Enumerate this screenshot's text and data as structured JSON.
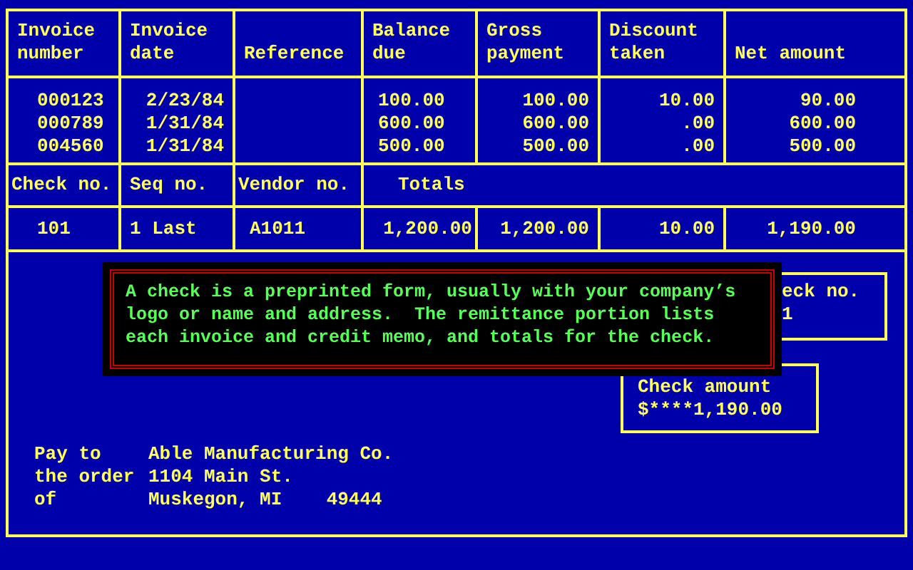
{
  "columns": [
    "Invoice number",
    "Invoice date",
    "Reference",
    "Balance due",
    "Gross payment",
    "Discount taken",
    "Net amount"
  ],
  "invoices": [
    {
      "number": "000123",
      "date": "2/23/84",
      "balance": "100.00",
      "gross": "100.00",
      "discount": "10.00",
      "net": "90.00"
    },
    {
      "number": "000789",
      "date": "1/31/84",
      "balance": "600.00",
      "gross": "600.00",
      "discount": ".00",
      "net": "600.00"
    },
    {
      "number": "004560",
      "date": "1/31/84",
      "balance": "500.00",
      "gross": "500.00",
      "discount": ".00",
      "net": "500.00"
    }
  ],
  "summary_labels": [
    "Check no.",
    "Seq no.",
    "Vendor no.",
    "Totals"
  ],
  "summary_values": {
    "check_no": "101",
    "seq_no": "1 Last",
    "vendor_no": "A1011",
    "balance": "1,200.00",
    "gross": "1,200.00",
    "discount": "10.00",
    "net": "1,190.00"
  },
  "check_number_box": {
    "label": "eck no.",
    "value": "1"
  },
  "check_amount_box": {
    "label": "Check amount",
    "value": "$****1,190.00"
  },
  "pay_to": {
    "label_lines": [
      "Pay to",
      "the order",
      "of"
    ],
    "address_lines": [
      "Able Manufacturing Co.",
      "1104 Main St.",
      "Muskegon, MI    49444"
    ]
  },
  "help_popup": {
    "text": "A check is a preprinted form, usually with your company’s logo or name and address.  The remittance portion lists each invoice and credit memo, and totals for the check."
  }
}
